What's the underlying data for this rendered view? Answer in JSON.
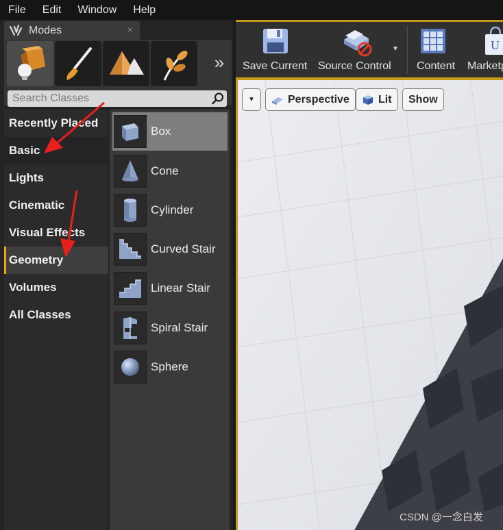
{
  "menubar": {
    "items": [
      {
        "label": "File"
      },
      {
        "label": "Edit"
      },
      {
        "label": "Window"
      },
      {
        "label": "Help"
      }
    ]
  },
  "modes_panel": {
    "tab_title": "Modes",
    "tab_close": "×",
    "mode_buttons": [
      {
        "icon": "place-mode-icon",
        "active": true
      },
      {
        "icon": "paint-brush-icon",
        "active": false
      },
      {
        "icon": "landscape-icon",
        "active": false
      },
      {
        "icon": "foliage-icon",
        "active": false
      }
    ],
    "more_label": "»",
    "search": {
      "placeholder": "Search Classes",
      "value": ""
    },
    "categories": [
      {
        "label": "Recently Placed"
      },
      {
        "label": "Basic"
      },
      {
        "label": "Lights"
      },
      {
        "label": "Cinematic"
      },
      {
        "label": "Visual Effects"
      },
      {
        "label": "Geometry",
        "selected": true
      },
      {
        "label": "Volumes"
      },
      {
        "label": "All Classes"
      }
    ],
    "assets": [
      {
        "label": "Box",
        "icon": "box-icon",
        "selected": true
      },
      {
        "label": "Cone",
        "icon": "cone-icon"
      },
      {
        "label": "Cylinder",
        "icon": "cylinder-icon"
      },
      {
        "label": "Curved Stair",
        "icon": "curved-stair-icon"
      },
      {
        "label": "Linear Stair",
        "icon": "linear-stair-icon"
      },
      {
        "label": "Spiral Stair",
        "icon": "spiral-stair-icon"
      },
      {
        "label": "Sphere",
        "icon": "sphere-icon"
      }
    ]
  },
  "toolbar": {
    "buttons": [
      {
        "label": "Save Current",
        "icon": "floppy-disk-icon"
      },
      {
        "label": "Source Control",
        "icon": "source-control-icon"
      },
      {
        "label": "Content",
        "icon": "content-grid-icon"
      },
      {
        "label": "Marketplace",
        "icon": "marketplace-bag-icon"
      }
    ],
    "dropdown_glyph": "▼"
  },
  "viewport": {
    "options_glyph": "▼",
    "perspective_label": "Perspective",
    "lit_label": "Lit",
    "show_label": "Show"
  },
  "watermark": "CSDN @一念白发",
  "colors": {
    "accent_orange": "#f0a510",
    "frame_gold": "#c79a16",
    "annotation_red": "#e8201c"
  }
}
